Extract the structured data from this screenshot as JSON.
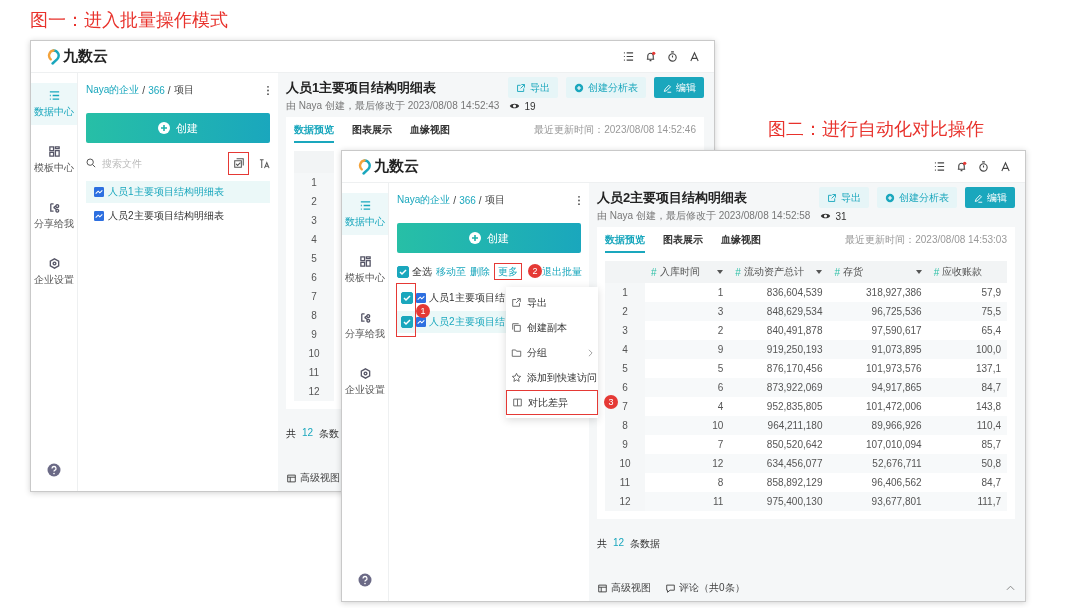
{
  "figures": [
    {
      "caption": "图一：进入批量操作模式",
      "window": {
        "logo": "九数云",
        "nav": [
          {
            "label": "数据中心",
            "selected": true
          },
          {
            "label": "模板中心",
            "selected": false
          },
          {
            "label": "分享给我",
            "selected": false
          },
          {
            "label": "企业设置",
            "selected": false
          }
        ],
        "sidebar": {
          "breadcrumb": [
            {
              "text": "Naya的企业",
              "link": true
            },
            {
              "text": "/",
              "link": false
            },
            {
              "text": "366",
              "link": true
            },
            {
              "text": "/",
              "link": false
            },
            {
              "text": "项目",
              "link": false
            }
          ],
          "create": "创建",
          "search": {
            "placeholder": "搜索文件",
            "batch_highlighted": true
          },
          "files": [
            {
              "name": "人员1主要项目结构明细表",
              "selected": true
            },
            {
              "name": "人员2主要项目结构明细表",
              "selected": false
            }
          ]
        },
        "main": {
          "title": "人员1主要项目结构明细表",
          "meta": "由 Naya 创建，最后修改于 2023/08/08 14:52:43",
          "views": "19",
          "buttons": [
            {
              "label": "导出",
              "kind": "light"
            },
            {
              "label": "创建分析表",
              "kind": "light"
            },
            {
              "label": "编辑",
              "kind": "primary"
            }
          ],
          "tabs": [
            {
              "label": "数据预览",
              "selected": true
            },
            {
              "label": "图表展示",
              "selected": false
            },
            {
              "label": "血缘视图",
              "selected": false
            }
          ],
          "updated": "最近更新时间：2023/08/08 14:52:46",
          "table": {
            "columns": [
              {}
            ],
            "rows": [
              {
                "cells": [
                  "1"
                ]
              },
              {
                "cells": [
                  "2"
                ]
              },
              {
                "cells": [
                  "3"
                ]
              },
              {
                "cells": [
                  "4"
                ]
              },
              {
                "cells": [
                  "5"
                ]
              },
              {
                "cells": [
                  "6"
                ]
              },
              {
                "cells": [
                  "7"
                ]
              },
              {
                "cells": [
                  "8"
                ]
              },
              {
                "cells": [
                  "9"
                ]
              },
              {
                "cells": [
                  "10"
                ]
              },
              {
                "cells": [
                  "11"
                ]
              },
              {
                "cells": [
                  "12"
                ]
              }
            ]
          },
          "footer": {
            "prefix": "共",
            "count": "12",
            "suffix": "条数",
            "links": [
              "高级视图"
            ]
          }
        }
      }
    },
    {
      "caption": "图二：进行自动化对比操作",
      "window": {
        "logo": "九数云",
        "nav": [
          {
            "label": "数据中心",
            "selected": true
          },
          {
            "label": "模板中心",
            "selected": false
          },
          {
            "label": "分享给我",
            "selected": false
          },
          {
            "label": "企业设置",
            "selected": false
          }
        ],
        "sidebar": {
          "breadcrumb": [
            {
              "text": "Naya的企业",
              "link": true
            },
            {
              "text": "/",
              "link": false
            },
            {
              "text": "366",
              "link": true
            },
            {
              "text": "/",
              "link": false
            },
            {
              "text": "项目",
              "link": false
            }
          ],
          "create": "创建",
          "batch": {
            "select_all": {
              "label": "全选",
              "checked": true
            },
            "actions": [
              "移动至",
              "删除"
            ],
            "more": {
              "label": "更多",
              "callout": "2",
              "menu": [
                {
                  "label": "导出"
                },
                {
                  "label": "创建副本"
                },
                {
                  "label": "分组",
                  "submenu": true
                },
                {
                  "label": "添加到快速访问"
                },
                {
                  "label": "对比差异",
                  "callout": "3"
                }
              ]
            },
            "exit": "退出批量"
          },
          "checks_callout": "1",
          "files": [
            {
              "name": "人员1主要项目结",
              "selected": false,
              "checked": true
            },
            {
              "name": "人员2主要项目结",
              "selected": true,
              "checked": true
            }
          ]
        },
        "main": {
          "title": "人员2主要项目结构明细表",
          "meta": "由 Naya 创建，最后修改于 2023/08/08 14:52:58",
          "views": "31",
          "buttons": [
            {
              "label": "导出",
              "kind": "light"
            },
            {
              "label": "创建分析表",
              "kind": "light"
            },
            {
              "label": "编辑",
              "kind": "primary"
            }
          ],
          "tabs": [
            {
              "label": "数据预览",
              "selected": true
            },
            {
              "label": "图表展示",
              "selected": false
            },
            {
              "label": "血缘视图",
              "selected": false
            }
          ],
          "updated": "最近更新时间：2023/08/08 14:53:03",
          "table": {
            "columns": [
              {},
              {
                "type": "#",
                "label": "入库时间",
                "menu": true
              },
              {
                "type": "#",
                "label": "流动资产总计",
                "menu": true
              },
              {
                "type": "#",
                "label": "存货",
                "menu": true
              },
              {
                "type": "#",
                "label": "应收账款"
              }
            ],
            "rows": [
              {
                "cells": [
                  "1",
                  "1",
                  "836,604,539",
                  "318,927,386",
                  "57,9"
                ]
              },
              {
                "cells": [
                  "2",
                  "3",
                  "848,629,534",
                  "96,725,536",
                  "75,5"
                ]
              },
              {
                "cells": [
                  "3",
                  "2",
                  "840,491,878",
                  "97,590,617",
                  "65,4"
                ]
              },
              {
                "cells": [
                  "4",
                  "9",
                  "919,250,193",
                  "91,073,895",
                  "100,0"
                ]
              },
              {
                "cells": [
                  "5",
                  "5",
                  "876,170,456",
                  "101,973,576",
                  "137,1"
                ]
              },
              {
                "cells": [
                  "6",
                  "6",
                  "873,922,069",
                  "94,917,865",
                  "84,7"
                ]
              },
              {
                "cells": [
                  "7",
                  "4",
                  "952,835,805",
                  "101,472,006",
                  "143,8"
                ]
              },
              {
                "cells": [
                  "8",
                  "10",
                  "964,211,180",
                  "89,966,926",
                  "110,4"
                ]
              },
              {
                "cells": [
                  "9",
                  "7",
                  "850,520,642",
                  "107,010,094",
                  "85,7"
                ]
              },
              {
                "cells": [
                  "10",
                  "12",
                  "634,456,077",
                  "52,676,711",
                  "50,8"
                ]
              },
              {
                "cells": [
                  "11",
                  "8",
                  "858,892,129",
                  "96,406,562",
                  "84,7"
                ]
              },
              {
                "cells": [
                  "12",
                  "11",
                  "975,400,130",
                  "93,677,801",
                  "111,7"
                ]
              }
            ]
          },
          "footer": {
            "prefix": "共",
            "count": "12",
            "suffix": "条数据",
            "links": [
              "高级视图",
              "评论（共0条）"
            ],
            "collapse_toggle": true
          }
        }
      }
    }
  ]
}
